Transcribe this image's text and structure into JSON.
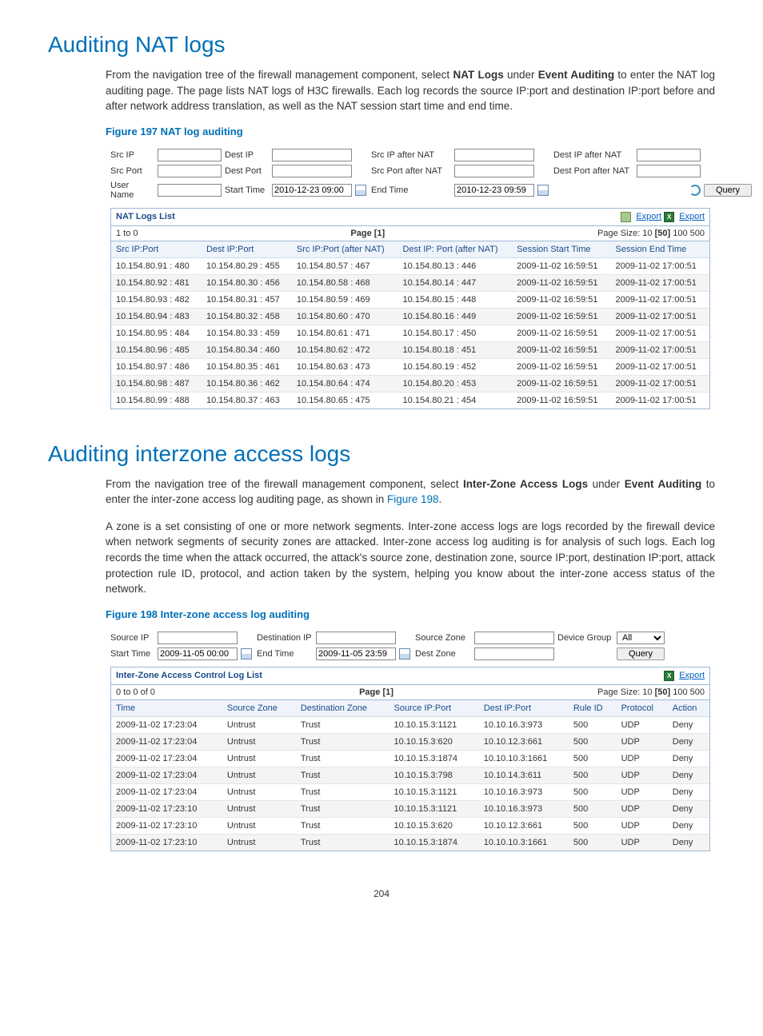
{
  "section1": {
    "heading": "Auditing NAT logs",
    "para": "From the navigation tree of the firewall management component, select NAT Logs under Event Auditing to enter the NAT log auditing page. The page lists NAT logs of H3C firewalls. Each log records the source IP:port and destination IP:port before and after network address translation, as well as the NAT session start time and end time.",
    "bold1": "NAT Logs",
    "bold2": "Event Auditing",
    "fig_caption": "Figure 197 NAT log auditing"
  },
  "nat_filter": {
    "labels": {
      "src_ip": "Src IP",
      "dest_ip": "Dest IP",
      "src_ip_after": "Src IP after NAT",
      "dest_ip_after": "Dest IP after NAT",
      "src_port": "Src Port",
      "dest_port": "Dest Port",
      "src_port_after": "Src Port after NAT",
      "dest_port_after": "Dest Port after NAT",
      "user_name": "User Name",
      "start_time": "Start Time",
      "end_time": "End Time",
      "query": "Query"
    },
    "start_time_val": "2010-12-23 09:00",
    "end_time_val": "2010-12-23 09:59"
  },
  "nat_panel": {
    "title": "NAT Logs List",
    "export": "Export",
    "nav_left": "1 to 0",
    "nav_center": "Page [1]",
    "nav_right_prefix": "Page Size: 10 ",
    "nav_right_bold": "[50]",
    "nav_right_suffix": " 100 500",
    "columns": [
      "Src IP:Port",
      "Dest IP:Port",
      "Src IP:Port (after NAT)",
      "Dest IP: Port (after NAT)",
      "Session Start Time",
      "Session End Time"
    ],
    "rows": [
      [
        "10.154.80.91 : 480",
        "10.154.80.29 : 455",
        "10.154.80.57 : 467",
        "10.154.80.13 : 446",
        "2009-11-02 16:59:51",
        "2009-11-02 17:00:51"
      ],
      [
        "10.154.80.92 : 481",
        "10.154.80.30 : 456",
        "10.154.80.58 : 468",
        "10.154.80.14 : 447",
        "2009-11-02 16:59:51",
        "2009-11-02 17:00:51"
      ],
      [
        "10.154.80.93 : 482",
        "10.154.80.31 : 457",
        "10.154.80.59 : 469",
        "10.154.80.15 : 448",
        "2009-11-02 16:59:51",
        "2009-11-02 17:00:51"
      ],
      [
        "10.154.80.94 : 483",
        "10.154.80.32 : 458",
        "10.154.80.60 : 470",
        "10.154.80.16 : 449",
        "2009-11-02 16:59:51",
        "2009-11-02 17:00:51"
      ],
      [
        "10.154.80.95 : 484",
        "10.154.80.33 : 459",
        "10.154.80.61 : 471",
        "10.154.80.17 : 450",
        "2009-11-02 16:59:51",
        "2009-11-02 17:00:51"
      ],
      [
        "10.154.80.96 : 485",
        "10.154.80.34 : 460",
        "10.154.80.62 : 472",
        "10.154.80.18 : 451",
        "2009-11-02 16:59:51",
        "2009-11-02 17:00:51"
      ],
      [
        "10.154.80.97 : 486",
        "10.154.80.35 : 461",
        "10.154.80.63 : 473",
        "10.154.80.19 : 452",
        "2009-11-02 16:59:51",
        "2009-11-02 17:00:51"
      ],
      [
        "10.154.80.98 : 487",
        "10.154.80.36 : 462",
        "10.154.80.64 : 474",
        "10.154.80.20 : 453",
        "2009-11-02 16:59:51",
        "2009-11-02 17:00:51"
      ],
      [
        "10.154.80.99 : 488",
        "10.154.80.37 : 463",
        "10.154.80.65 : 475",
        "10.154.80.21 : 454",
        "2009-11-02 16:59:51",
        "2009-11-02 17:00:51"
      ]
    ]
  },
  "section2": {
    "heading": "Auditing interzone access logs",
    "para1_pre": "From the navigation tree of the firewall management component, select ",
    "para1_b1": "Inter-Zone Access Logs",
    "para1_mid": " under ",
    "para1_b2": "Event Auditing",
    "para1_post": " to enter the inter-zone access log auditing page, as shown in ",
    "para1_link": "Figure 198",
    "para2": "A zone is a set consisting of one or more network segments. Inter-zone access logs are logs recorded by the firewall device when network segments of security zones are attacked. Inter-zone access log auditing is for analysis of such logs. Each log records the time when the attack occurred, the attack's source zone, destination zone, source IP:port, destination IP:port, attack protection rule ID, protocol, and action taken by the system, helping you know about the inter-zone access status of the network.",
    "fig_caption": "Figure 198 Inter-zone access log auditing"
  },
  "iz_filter": {
    "labels": {
      "source_ip": "Source IP",
      "dest_ip": "Destination IP",
      "source_zone": "Source Zone",
      "device_group": "Device Group",
      "all_opt": "All",
      "start_time": "Start Time",
      "end_time": "End Time",
      "dest_zone": "Dest Zone",
      "query": "Query"
    },
    "start_time_val": "2009-11-05 00:00",
    "end_time_val": "2009-11-05 23:59"
  },
  "iz_panel": {
    "title": "Inter-Zone Access Control Log List",
    "export": "Export",
    "nav_left": "0 to 0 of 0",
    "nav_center": "Page [1]",
    "nav_right_prefix": "Page Size: 10 ",
    "nav_right_bold": "[50]",
    "nav_right_suffix": " 100 500",
    "columns": [
      "Time",
      "Source Zone",
      "Destination Zone",
      "Source IP:Port",
      "Dest IP:Port",
      "Rule ID",
      "Protocol",
      "Action"
    ],
    "rows": [
      [
        "2009-11-02 17:23:04",
        "Untrust",
        "Trust",
        "10.10.15.3:1121",
        "10.10.16.3:973",
        "500",
        "UDP",
        "Deny"
      ],
      [
        "2009-11-02 17:23:04",
        "Untrust",
        "Trust",
        "10.10.15.3:620",
        "10.10.12.3:661",
        "500",
        "UDP",
        "Deny"
      ],
      [
        "2009-11-02 17:23:04",
        "Untrust",
        "Trust",
        "10.10.15.3:1874",
        "10.10.10.3:1661",
        "500",
        "UDP",
        "Deny"
      ],
      [
        "2009-11-02 17:23:04",
        "Untrust",
        "Trust",
        "10.10.15.3:798",
        "10.10.14.3:611",
        "500",
        "UDP",
        "Deny"
      ],
      [
        "2009-11-02 17:23:04",
        "Untrust",
        "Trust",
        "10.10.15.3:1121",
        "10.10.16.3:973",
        "500",
        "UDP",
        "Deny"
      ],
      [
        "2009-11-02 17:23:10",
        "Untrust",
        "Trust",
        "10.10.15.3:1121",
        "10.10.16.3:973",
        "500",
        "UDP",
        "Deny"
      ],
      [
        "2009-11-02 17:23:10",
        "Untrust",
        "Trust",
        "10.10.15.3:620",
        "10.10.12.3:661",
        "500",
        "UDP",
        "Deny"
      ],
      [
        "2009-11-02 17:23:10",
        "Untrust",
        "Trust",
        "10.10.15.3:1874",
        "10.10.10.3:1661",
        "500",
        "UDP",
        "Deny"
      ]
    ]
  },
  "page_number": "204"
}
